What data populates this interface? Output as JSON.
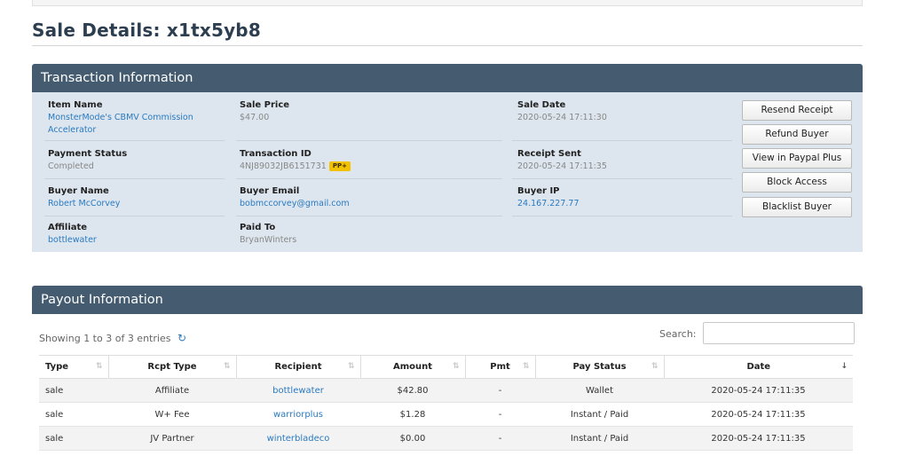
{
  "page": {
    "title": "Sale Details: x1tx5yb8"
  },
  "transaction": {
    "header": "Transaction Information",
    "item_name": {
      "label": "Item Name",
      "value": "MonsterMode's CBMV Commission Accelerator"
    },
    "sale_price": {
      "label": "Sale Price",
      "value": "$47.00"
    },
    "sale_date": {
      "label": "Sale Date",
      "value": "2020-05-24 17:11:30"
    },
    "payment_status": {
      "label": "Payment Status",
      "value": "Completed"
    },
    "transaction_id": {
      "label": "Transaction ID",
      "value": "4NJ89032JB6151731",
      "badge": "PP+"
    },
    "receipt_sent": {
      "label": "Receipt Sent",
      "value": "2020-05-24 17:11:35"
    },
    "buyer_name": {
      "label": "Buyer Name",
      "value": "Robert McCorvey"
    },
    "buyer_email": {
      "label": "Buyer Email",
      "value": "bobmccorvey@gmail.com"
    },
    "buyer_ip": {
      "label": "Buyer IP",
      "value": "24.167.227.77"
    },
    "affiliate": {
      "label": "Affiliate",
      "value": "bottlewater"
    },
    "paid_to": {
      "label": "Paid To",
      "value": "BryanWinters"
    },
    "buttons": {
      "resend_receipt": "Resend Receipt",
      "refund_buyer": "Refund Buyer",
      "view_paypal_plus": "View in Paypal Plus",
      "block_access": "Block Access",
      "blacklist_buyer": "Blacklist Buyer"
    }
  },
  "payout": {
    "header": "Payout Information",
    "showing": "Showing 1 to 3 of 3 entries",
    "search_label": "Search:",
    "columns": [
      "Type",
      "Rcpt Type",
      "Recipient",
      "Amount",
      "Pmt",
      "Pay Status",
      "Date"
    ],
    "rows": [
      {
        "type": "sale",
        "rcpt_type": "Affiliate",
        "recipient": "bottlewater",
        "amount": "$42.80",
        "pmt": "-",
        "pay_status": "Wallet",
        "date": "2020-05-24 17:11:35"
      },
      {
        "type": "sale",
        "rcpt_type": "W+ Fee",
        "recipient": "warriorplus",
        "amount": "$1.28",
        "pmt": "-",
        "pay_status": "Instant / Paid",
        "date": "2020-05-24 17:11:35"
      },
      {
        "type": "sale",
        "rcpt_type": "JV Partner",
        "recipient": "winterbladeco",
        "amount": "$0.00",
        "pmt": "-",
        "pay_status": "Instant / Paid",
        "date": "2020-05-24 17:11:35"
      }
    ]
  }
}
